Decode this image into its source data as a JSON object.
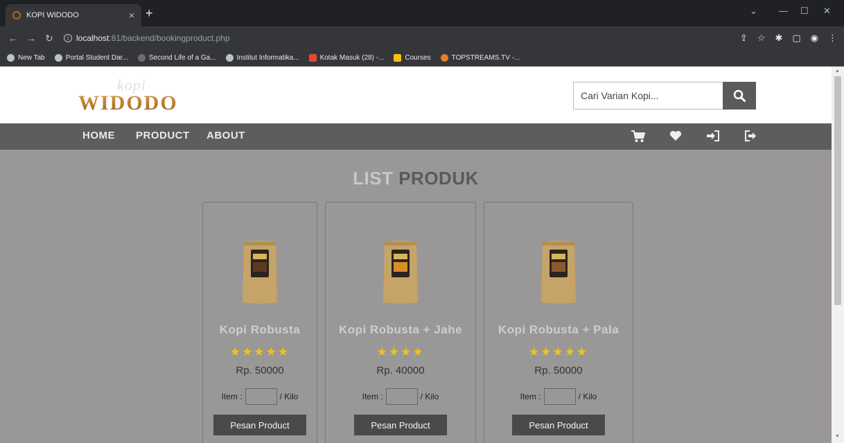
{
  "browser": {
    "tab_title": "KOPI WIDODO",
    "tab_close": "×",
    "new_tab": "+",
    "url_host": "localhost",
    "url_path": ":81/backend/bookingproduct.php",
    "bookmarks": [
      "New Tab",
      "Portal Student Dar...",
      "Second Life of a Ga...",
      "Institut Informatika...",
      "Kotak Masuk (28) -...",
      "Courses",
      "TOPSTREAMS.TV -..."
    ]
  },
  "header": {
    "logo_top": "kopi",
    "logo_main": "WIDODO",
    "search_placeholder": "Cari Varian Kopi..."
  },
  "nav": {
    "items": [
      "HOME",
      "PRODUCT",
      "ABOUT"
    ]
  },
  "main": {
    "title_part1": "LIST",
    "title_part2": "PRODUK",
    "products": [
      {
        "name": "Kopi Robusta",
        "stars": "★★★★★",
        "rating": 5,
        "price": "Rp. 50000",
        "qty_label": "Item :",
        "unit_label": "/ Kilo",
        "button": "Pesan Product"
      },
      {
        "name": "Kopi Robusta + Jahe",
        "stars": "★★★★",
        "rating": 4,
        "price": "Rp. 40000",
        "qty_label": "Item :",
        "unit_label": "/ Kilo",
        "button": "Pesan Product"
      },
      {
        "name": "Kopi Robusta + Pala",
        "stars": "★★★★★",
        "rating": 5,
        "price": "Rp. 50000",
        "qty_label": "Item :",
        "unit_label": "/ Kilo",
        "button": "Pesan Product"
      }
    ]
  },
  "colors": {
    "page_bg": "#9a9797",
    "navbar_bg": "#5d5d5d",
    "button_bg": "#4a4a4a",
    "star": "#f2c21a",
    "logo_gold": "#b8792c"
  }
}
